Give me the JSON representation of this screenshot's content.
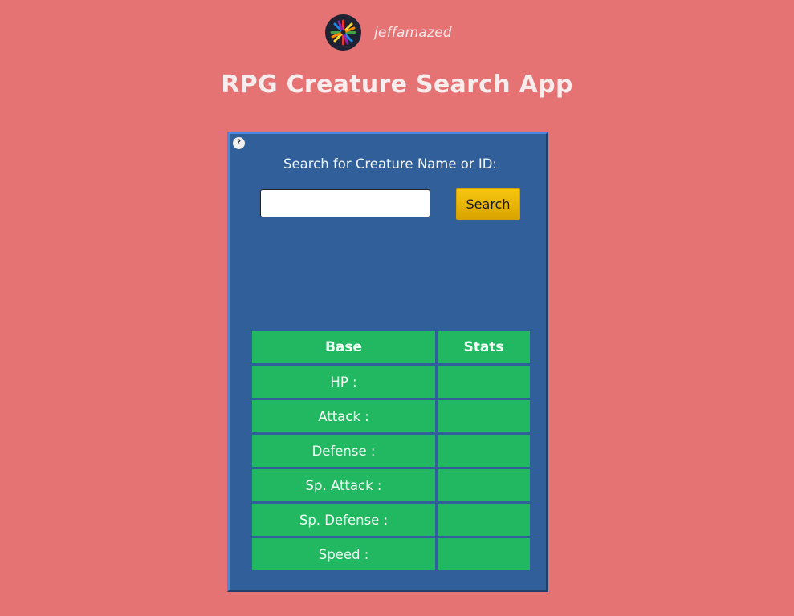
{
  "brand": {
    "name": "jeffamazed",
    "logo_icon": "colorful-asterisk-logo"
  },
  "page": {
    "title": "RPG Creature Search App"
  },
  "card": {
    "help_icon_glyph": "?",
    "search_label": "Search for Creature Name or ID:",
    "search_input_value": "",
    "search_button_label": "Search"
  },
  "table": {
    "headers": [
      "Base",
      "Stats"
    ],
    "rows": [
      {
        "label": "HP :",
        "value": ""
      },
      {
        "label": "Attack :",
        "value": ""
      },
      {
        "label": "Defense :",
        "value": ""
      },
      {
        "label": "Sp. Attack :",
        "value": ""
      },
      {
        "label": "Sp. Defense :",
        "value": ""
      },
      {
        "label": "Speed :",
        "value": ""
      }
    ]
  },
  "colors": {
    "background": "#e57373",
    "card": "#305f99",
    "table_cell": "#22b862",
    "button": "#f6c60f"
  }
}
